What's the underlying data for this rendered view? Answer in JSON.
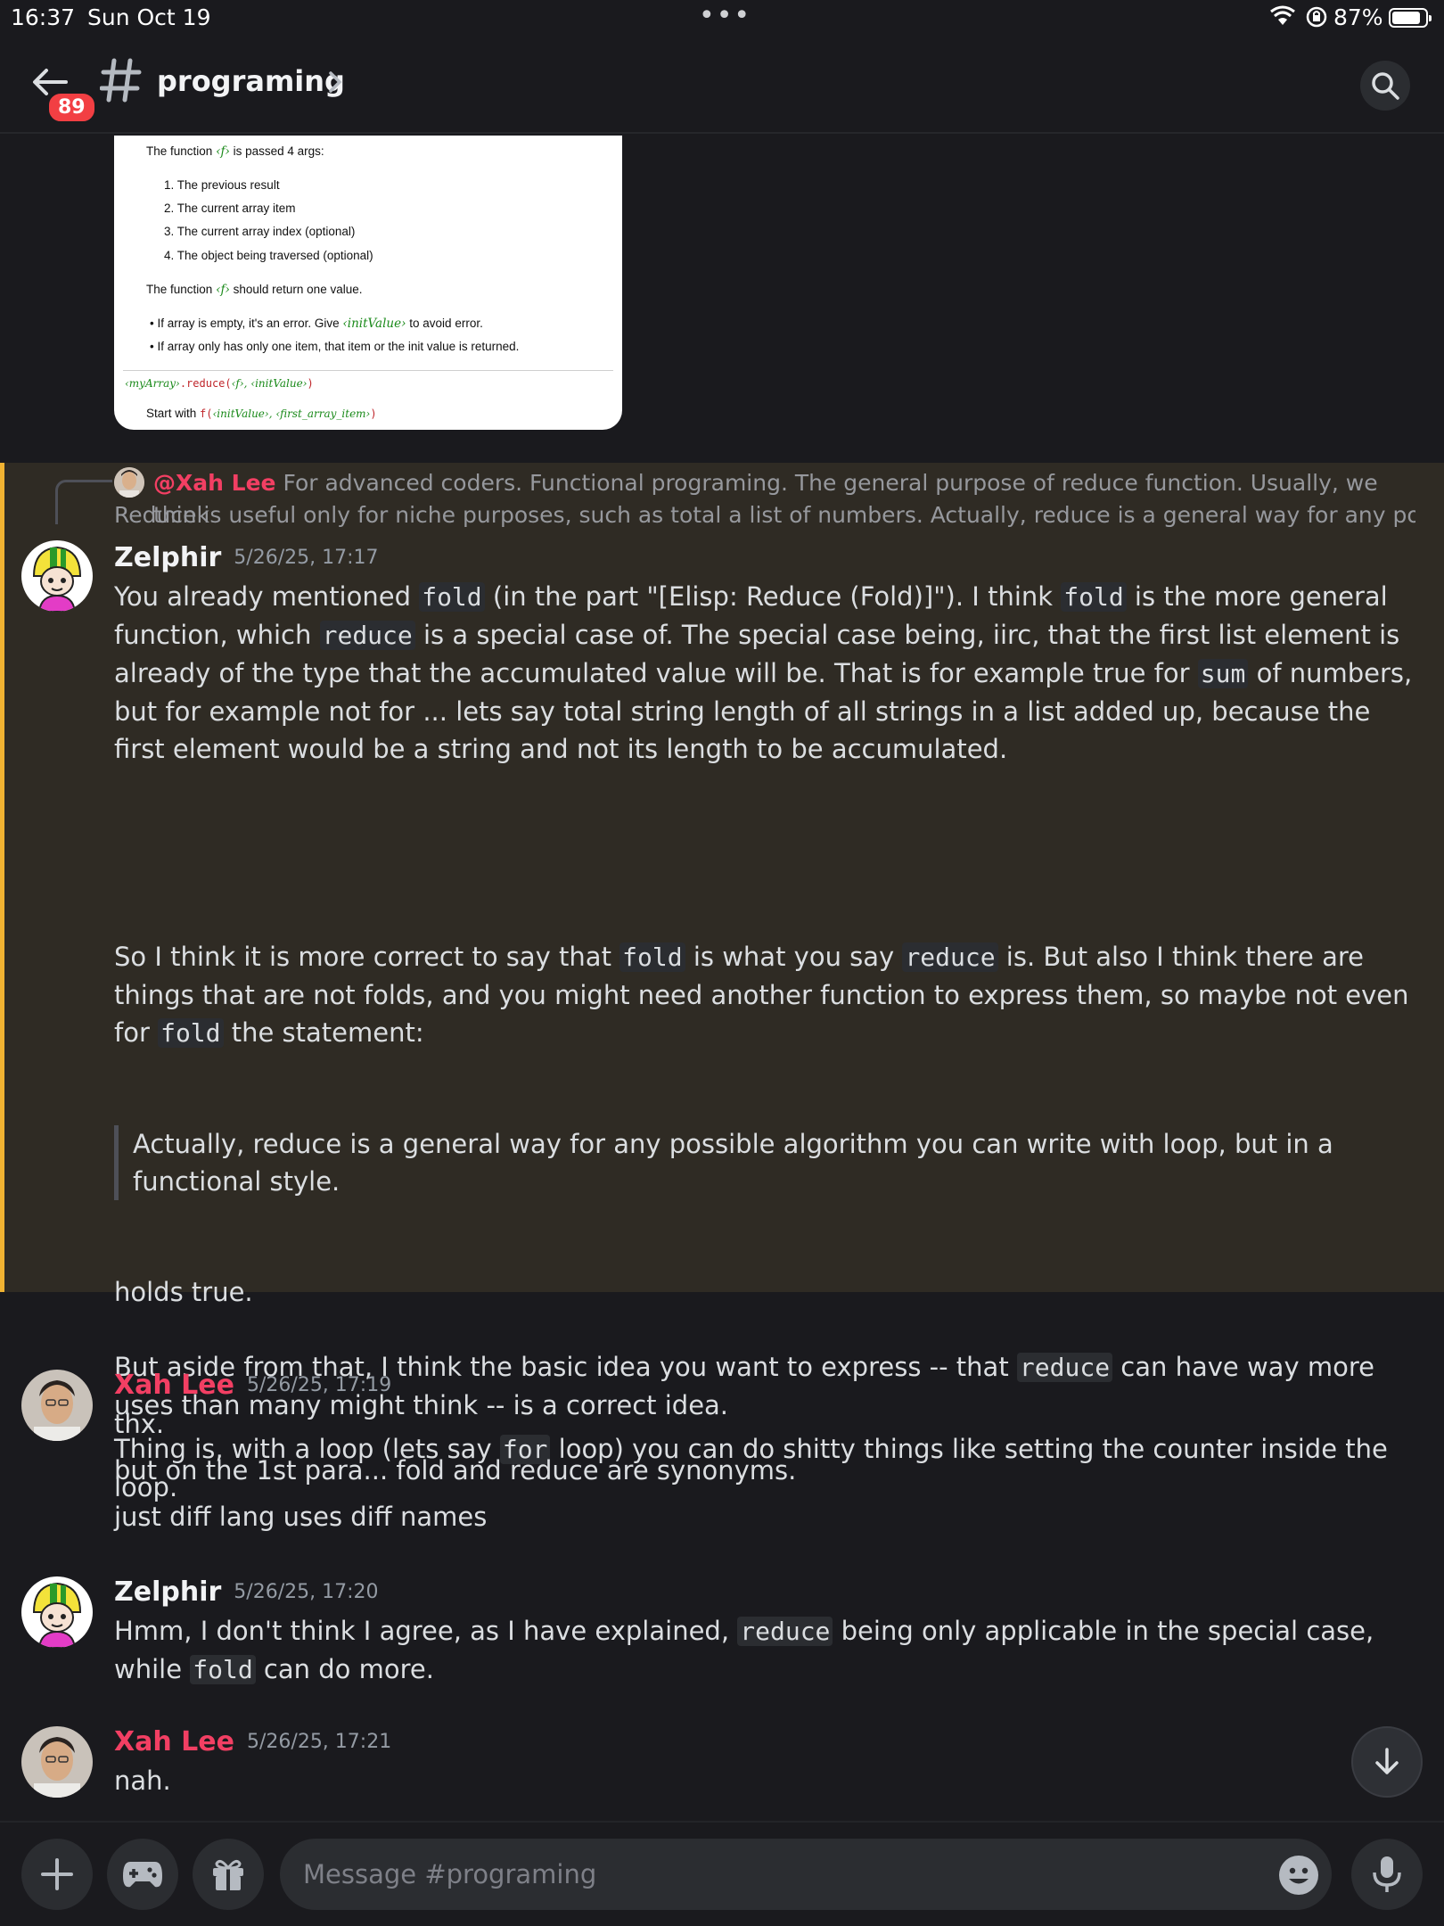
{
  "status_bar": {
    "time": "16:37",
    "date": "Sun Oct 19",
    "battery_pct": "87%",
    "battery_level": 0.87
  },
  "header": {
    "unread_count": "89",
    "channel_name": "programing"
  },
  "embedded_image": {
    "line1_a": "The function",
    "line1_f": "‹f›",
    "line1_b": "is passed 4 args:",
    "items": [
      "1. The previous result",
      "2. The current array item",
      "3. The current array index (optional)",
      "4. The object being traversed (optional)"
    ],
    "ret_a": "The function",
    "ret_f": "‹f›",
    "ret_b": "should return one value.",
    "bullet1_a": "If array is empty, it's an error. Give",
    "bullet1_code": "‹initValue›",
    "bullet1_b": "to avoid error.",
    "bullet2": "If array only has only one item, that item or the init value is returned.",
    "sig_a": "‹myArray›",
    "sig_b": ".reduce(",
    "sig_c": "‹f›, ‹initValue›",
    "sig_d": ")",
    "start_a": "Start with",
    "start_b": "f(",
    "start_c": "‹initValue›, ‹first_array_item›",
    "start_d": ")"
  },
  "reply_preview": {
    "author": "@Xah Lee",
    "line1": "For advanced coders. Functional programing. The general purpose of reduce function.  Usually, we think",
    "line2": "Reduce is useful only for niche purposes, such as total a list of numbers.  Actually, reduce is a general way for any possible..."
  },
  "messages": [
    {
      "author": "Zelphir",
      "time": "5/26/25, 17:17",
      "p1": {
        "t1": "You already mentioned ",
        "c1": "fold",
        "t2": " (in the part \"[Elisp: Reduce (Fold)]\"). I think ",
        "c2": "fold",
        "t3": " is the more general function, which ",
        "c3": "reduce",
        "t4": " is a special case of. The special case being, iirc, that the first list element is already of the type that the accumulated value will be. That is for example true for ",
        "c4": "sum",
        "t5": " of numbers, but for example not for ... lets say total string length of all strings in a list added up, because the first element would be a string and not its length to be accumulated."
      },
      "p2": {
        "t1": "So I think it is more correct to say that ",
        "c1": "fold",
        "t2": " is what you say ",
        "c2": "reduce",
        "t3": " is. But also I think there are things that are not folds, and you might need another function to express them, so maybe not even for ",
        "c3": "fold",
        "t4": " the statement:"
      },
      "quote": "Actually, reduce is a general way for any possible algorithm you can write with loop, but in a functional style.",
      "p3": "holds true.",
      "p4": {
        "t1": "But aside from that, I think the basic idea you want to express -- that ",
        "c1": "reduce",
        "t2": " can have way more uses than many might think -- is a correct idea."
      },
      "p5": {
        "t1": "Thing is, with a loop (lets say ",
        "c1": "for",
        "t2": " loop) you can do shitty things like setting the counter inside the loop."
      }
    },
    {
      "author": "Xah Lee",
      "time": "5/26/25, 17:19",
      "lines": [
        "thx.",
        "but on the 1st para... fold and reduce are synonyms.",
        "just diff lang uses diff names"
      ]
    },
    {
      "author": "Zelphir",
      "time": "5/26/25, 17:20",
      "p1": {
        "t1": "Hmm, I don't think I agree, as I have explained, ",
        "c1": "reduce",
        "t2": " being only applicable in the special case, while ",
        "c2": "fold",
        "t3": " can do more."
      }
    },
    {
      "author": "Xah Lee",
      "time": "5/26/25, 17:21",
      "lines": [
        "nah."
      ]
    }
  ],
  "composer": {
    "placeholder": "Message #programing"
  },
  "colors": {
    "mention_highlight": "#2f2b24",
    "mention_bar": "#f0b232",
    "xah_name": "#f23f63",
    "badge": "#f23f43"
  },
  "icons": [
    "back-arrow-icon",
    "hash-icon",
    "chevron-right-icon",
    "search-icon",
    "plus-icon",
    "gamepad-icon",
    "gift-icon",
    "emoji-icon",
    "microphone-icon",
    "arrow-down-icon",
    "wifi-icon",
    "orientation-lock-icon",
    "battery-icon"
  ]
}
